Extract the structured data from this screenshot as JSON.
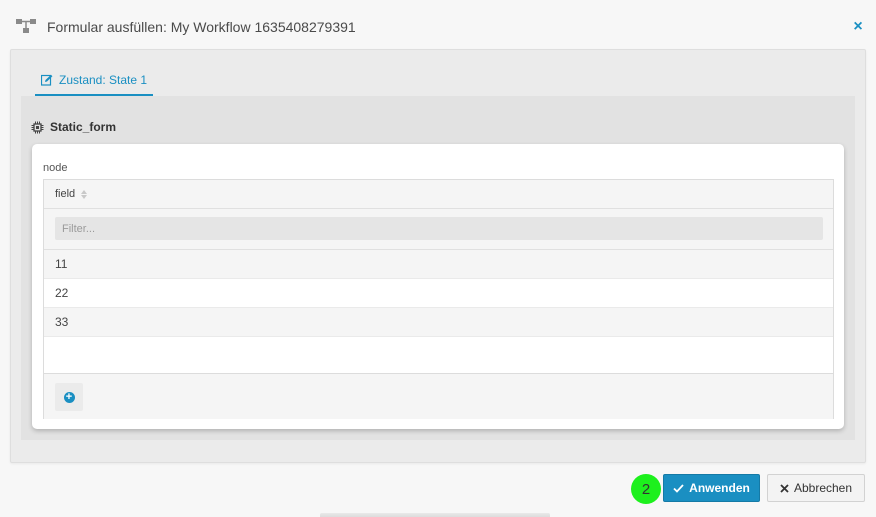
{
  "header": {
    "title": "Formular ausfüllen: My Workflow 1635408279391",
    "close_symbol": "×",
    "workflow_icon": "workflow-icon"
  },
  "tabs": [
    {
      "label": "Zustand: State 1",
      "icon": "edit-icon",
      "active": true
    }
  ],
  "form": {
    "title": "Static_form",
    "icon": "chip-icon",
    "node_label": "node",
    "grid": {
      "column": "field",
      "filter_placeholder": "Filter...",
      "rows": [
        "11",
        "22",
        "33"
      ],
      "add_icon": "plus-circle-icon"
    }
  },
  "footer": {
    "step_number": "2",
    "apply_label": "Anwenden",
    "apply_icon": "check-icon",
    "cancel_label": "Abbrechen",
    "cancel_icon": "x-icon"
  },
  "colors": {
    "accent": "#1a8fc2",
    "step_badge": "#1df01d",
    "panel": "#ebebeb"
  }
}
